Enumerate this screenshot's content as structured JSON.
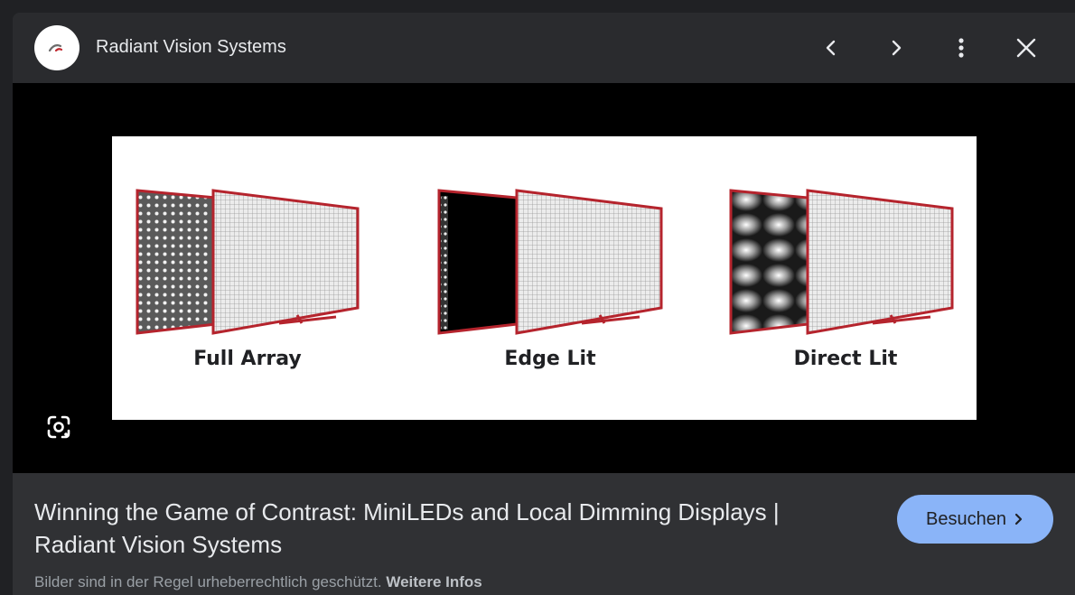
{
  "header": {
    "site_name": "Radiant Vision Systems",
    "icons": [
      "chevron-left-icon",
      "chevron-right-icon",
      "more-vert-icon",
      "close-icon"
    ]
  },
  "image": {
    "labels": [
      "Full Array",
      "Edge Lit",
      "Direct Lit"
    ],
    "frame_color": "#b5242d"
  },
  "footer": {
    "title": "Winning the Game of Contrast: MiniLEDs and Local Dimming Displays | Radiant Vision Systems",
    "visit_label": "Besuchen",
    "copyright_text": "Bilder sind in der Regel urheberrechtlich geschützt.",
    "more_info_label": "Weitere Infos"
  },
  "colors": {
    "accent": "#8ab4f8",
    "panel": "#303134",
    "background": "#202124"
  }
}
